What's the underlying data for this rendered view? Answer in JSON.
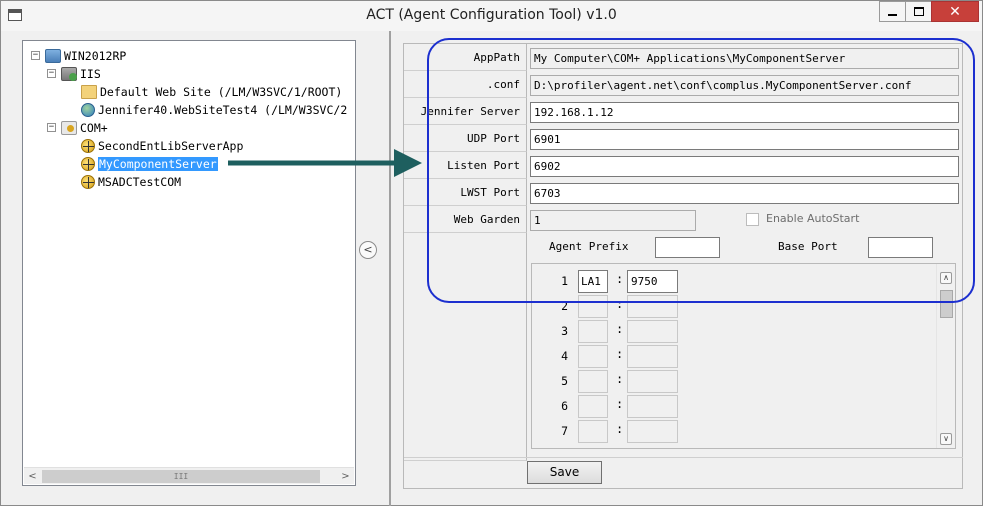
{
  "window": {
    "title": "ACT (Agent Configuration Tool) v1.0",
    "close_glyph": "✕"
  },
  "tree": {
    "root": "WIN2012RP",
    "iis": "IIS",
    "iis_items": [
      "Default Web Site (/LM/W3SVC/1/ROOT)",
      "Jennifer40.WebSiteTest4 (/LM/W3SVC/2"
    ],
    "complus": "COM+",
    "complus_items": [
      "SecondEntLibServerApp",
      "MyComponentServer",
      "MSADCTestCOM"
    ],
    "selected": "MyComponentServer",
    "hscroll_grip": "III"
  },
  "properties": {
    "apppath_label": "AppPath",
    "apppath_value": "My Computer\\COM+ Applications\\MyComponentServer",
    "conf_label": ".conf",
    "conf_value": "D:\\profiler\\agent.net\\conf\\complus.MyComponentServer.conf",
    "jennifer_label": "Jennifer Server",
    "jennifer_value": "192.168.1.12",
    "udp_label": "UDP Port",
    "udp_value": "6901",
    "listen_label": "Listen Port",
    "listen_value": "6902",
    "lwst_label": "LWST Port",
    "lwst_value": "6703",
    "webgarden_label": "Web Garden",
    "webgarden_value": "1",
    "autostart_label": "Enable AutoStart"
  },
  "agents": {
    "prefix_label": "Agent Prefix",
    "baseport_label": "Base Port",
    "rows": [
      {
        "num": "1",
        "prefix": "LA1",
        "port": "9750"
      },
      {
        "num": "2",
        "prefix": "",
        "port": ""
      },
      {
        "num": "3",
        "prefix": "",
        "port": ""
      },
      {
        "num": "4",
        "prefix": "",
        "port": ""
      },
      {
        "num": "5",
        "prefix": "",
        "port": ""
      },
      {
        "num": "6",
        "prefix": "",
        "port": ""
      },
      {
        "num": "7",
        "prefix": "",
        "port": ""
      }
    ]
  },
  "save_label": "Save",
  "colors": {
    "highlight": "#1c2fcf",
    "arrow": "#1e5f5f",
    "selection": "#3399ff",
    "close": "#c7403a"
  }
}
